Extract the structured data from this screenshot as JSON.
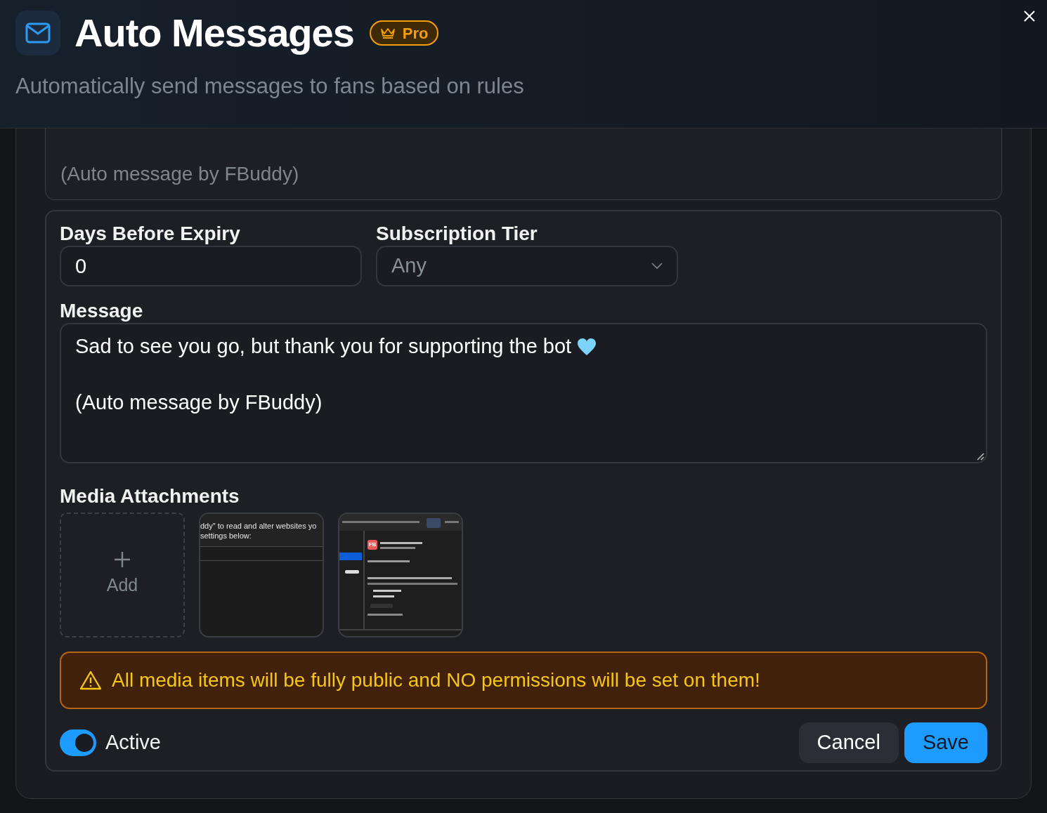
{
  "header": {
    "title": "Auto Messages",
    "badge": "Pro",
    "subtitle": "Automatically send messages to fans based on rules"
  },
  "previous_rule": {
    "message_tail": "(Auto message by FBuddy)"
  },
  "rule": {
    "days_before_expiry": {
      "label": "Days Before Expiry",
      "value": "0"
    },
    "subscription_tier": {
      "label": "Subscription Tier",
      "value": "Any"
    },
    "message": {
      "label": "Message",
      "paragraphs": [
        "Sad to see you go, but thank you for supporting the bot",
        "(Auto message by FBuddy)"
      ]
    },
    "media": {
      "label": "Media Attachments",
      "add_label": "Add",
      "items": [
        {
          "kind": "text-screenshot",
          "lines": [
            "ddy\" to read and alter websites yo",
            "settings below:"
          ]
        },
        {
          "kind": "app-screenshot",
          "badge": "FB"
        }
      ]
    },
    "warning": "All media items will be fully public and NO permissions will be set on them!",
    "active": {
      "label": "Active",
      "on": true
    },
    "buttons": {
      "cancel": "Cancel",
      "save": "Save"
    }
  }
}
